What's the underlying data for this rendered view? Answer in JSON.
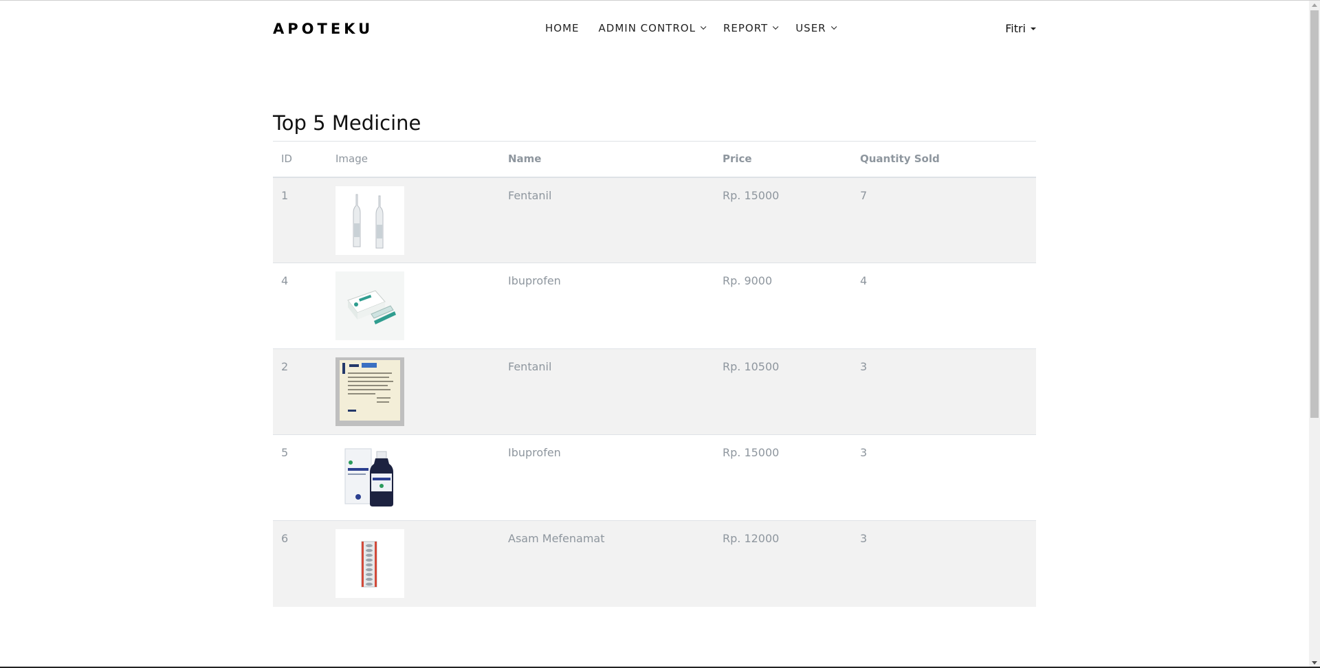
{
  "brand": "APOTEKU",
  "nav": {
    "items": [
      {
        "label": "HOME",
        "dropdown": false
      },
      {
        "label": "ADMIN CONTROL",
        "dropdown": true
      },
      {
        "label": "REPORT",
        "dropdown": true
      },
      {
        "label": "USER",
        "dropdown": true
      }
    ],
    "user": "Fitri"
  },
  "section_title": "Top 5 Medicine",
  "table": {
    "headers": {
      "id": "ID",
      "image": "Image",
      "name": "Name",
      "price": "Price",
      "qty": "Quantity Sold"
    },
    "rows": [
      {
        "id": "1",
        "name": "Fentanil",
        "price": "Rp. 15000",
        "qty": "7",
        "image_icon": "ampoule-vials-image"
      },
      {
        "id": "4",
        "name": "Ibuprofen",
        "price": "Rp. 9000",
        "qty": "4",
        "image_icon": "tablet-box-image"
      },
      {
        "id": "2",
        "name": "Fentanil",
        "price": "Rp. 10500",
        "qty": "3",
        "image_icon": "patch-sachet-image"
      },
      {
        "id": "5",
        "name": "Ibuprofen",
        "price": "Rp. 15000",
        "qty": "3",
        "image_icon": "syrup-bottle-image"
      },
      {
        "id": "6",
        "name": "Asam Mefenamat",
        "price": "Rp. 12000",
        "qty": "3",
        "image_icon": "tablet-strip-image"
      }
    ]
  },
  "colors": {
    "row_stripe": "#f2f2f2",
    "muted_text": "#8e969e",
    "border": "#dee2e6"
  }
}
